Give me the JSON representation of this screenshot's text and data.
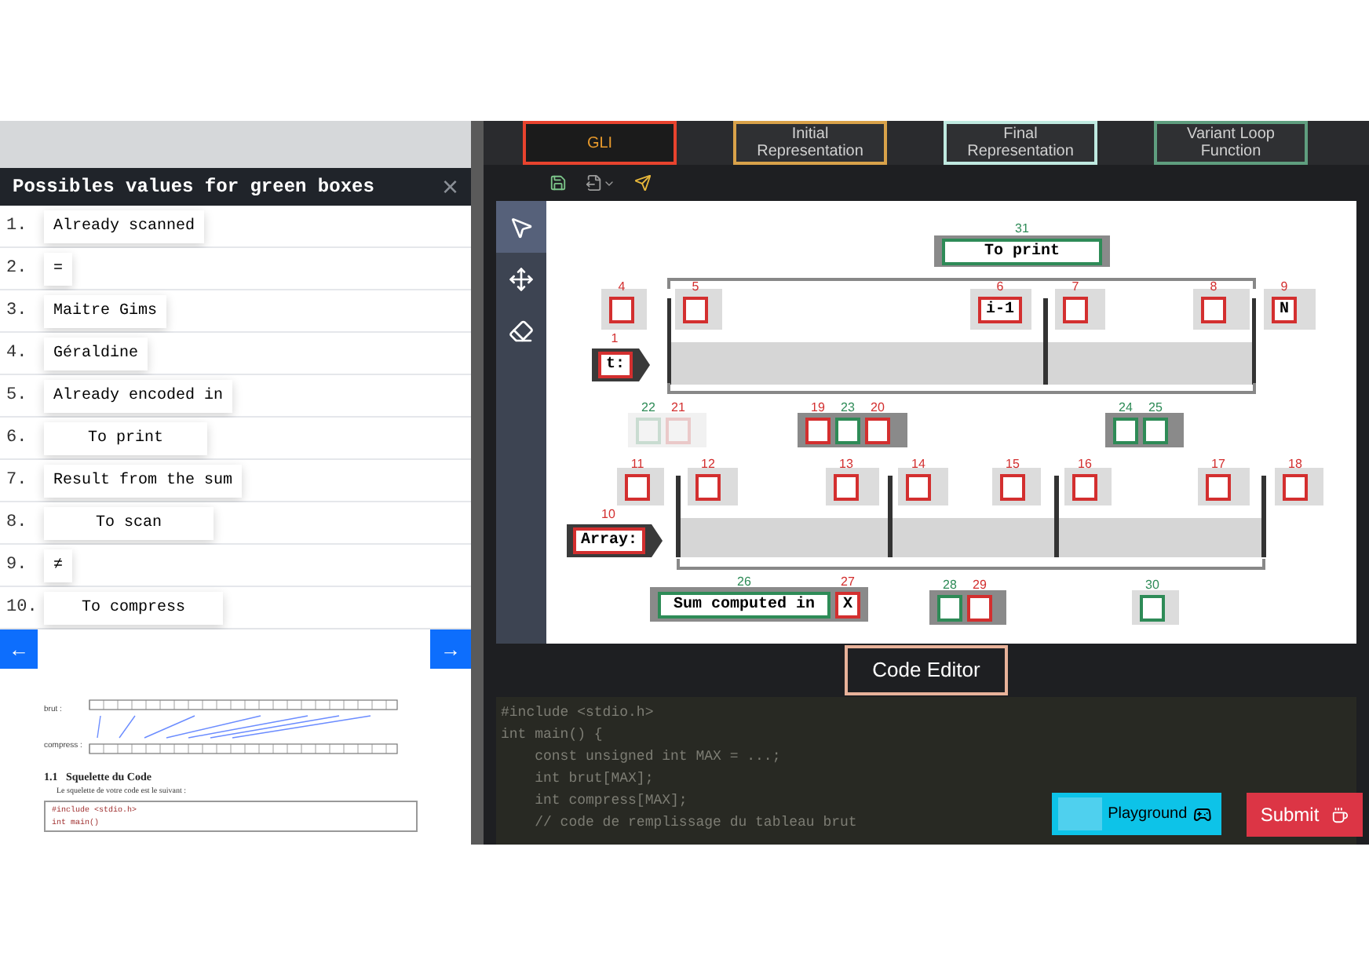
{
  "panel": {
    "title": "Possibles values for green boxes",
    "close": "×",
    "values": [
      {
        "number": "1.",
        "text": "Already scanned"
      },
      {
        "number": "2.",
        "text": "="
      },
      {
        "number": "3.",
        "text": "Maitre Gims"
      },
      {
        "number": "4.",
        "text": "Géraldine"
      },
      {
        "number": "5.",
        "text": "Already encoded in"
      },
      {
        "number": "6.",
        "text": "To print"
      },
      {
        "number": "7.",
        "text": "Result from the sum"
      },
      {
        "number": "8.",
        "text": "To scan"
      },
      {
        "number": "9.",
        "text": "≠"
      },
      {
        "number": "10.",
        "text": "To compress"
      }
    ],
    "prev": "←",
    "next": "→"
  },
  "document": {
    "row_labels": [
      "brut :",
      "compress :"
    ],
    "heading": "1.1   Squelette du Code",
    "sentence": "Le squelette de votre code est le suivant :",
    "code": [
      "#include <stdio.h>",
      "int main()"
    ]
  },
  "tabs": [
    {
      "label": "GLI",
      "selected": true,
      "color": "#e8432e"
    },
    {
      "label": "Initial Representation",
      "selected": false,
      "color": "#d9a24a"
    },
    {
      "label": "Final Representation",
      "selected": false,
      "color": "#bfe9e0"
    },
    {
      "label": "Variant Loop Function",
      "selected": false,
      "color": "#5f9e7f"
    }
  ],
  "tools": [
    {
      "selected": true
    },
    {
      "selected": false
    },
    {
      "selected": false
    }
  ],
  "diagram": {
    "labels": [
      {
        "number": "1",
        "text": "t:"
      },
      {
        "number": "10",
        "text": "Array:"
      }
    ],
    "boxes": [
      {
        "number": "31",
        "color": "#2e8b57",
        "value": "To print",
        "faded": false
      },
      {
        "number": "4",
        "color": "#d32f2f",
        "faded": false
      },
      {
        "number": "5",
        "color": "#d32f2f",
        "faded": false
      },
      {
        "number": "6",
        "color": "#d32f2f",
        "value": "i-1",
        "faded": false
      },
      {
        "number": "7",
        "color": "#d32f2f",
        "faded": false
      },
      {
        "number": "8",
        "color": "#d32f2f",
        "faded": false
      },
      {
        "number": "9",
        "color": "#d32f2f",
        "value": "N",
        "faded": false
      },
      {
        "number": "22",
        "color": "#2e8b57",
        "faded": true
      },
      {
        "number": "21",
        "color": "#d32f2f",
        "faded": true
      },
      {
        "number": "19",
        "color": "#d32f2f",
        "faded": false
      },
      {
        "number": "23",
        "color": "#2e8b57",
        "faded": false
      },
      {
        "number": "20",
        "color": "#d32f2f",
        "faded": false
      },
      {
        "number": "24",
        "color": "#2e8b57",
        "faded": false
      },
      {
        "number": "25",
        "color": "#2e8b57",
        "faded": false
      },
      {
        "number": "11",
        "color": "#d32f2f",
        "faded": false
      },
      {
        "number": "12",
        "color": "#d32f2f",
        "faded": false
      },
      {
        "number": "13",
        "color": "#d32f2f",
        "faded": false
      },
      {
        "number": "14",
        "color": "#d32f2f",
        "faded": false
      },
      {
        "number": "15",
        "color": "#d32f2f",
        "faded": false
      },
      {
        "number": "16",
        "color": "#d32f2f",
        "faded": false
      },
      {
        "number": "17",
        "color": "#d32f2f",
        "faded": false
      },
      {
        "number": "18",
        "color": "#d32f2f",
        "faded": false
      },
      {
        "number": "26",
        "color": "#2e8b57",
        "value": "Sum computed in",
        "faded": false
      },
      {
        "number": "27",
        "color": "#d32f2f",
        "value": "X",
        "faded": false
      },
      {
        "number": "28",
        "color": "#2e8b57",
        "faded": false
      },
      {
        "number": "29",
        "color": "#d32f2f",
        "faded": false
      },
      {
        "number": "30",
        "color": "#2e8b57",
        "faded": false
      }
    ]
  },
  "code_editor": {
    "title": "Code Editor",
    "lines": [
      "#include <stdio.h>",
      "int main() {",
      "    const unsigned int MAX = ...;",
      "    int brut[MAX];",
      "    int compress[MAX];",
      "    // code de remplissage du tableau brut"
    ]
  },
  "buttons": [
    {
      "label": "Playground",
      "kind": "playground"
    },
    {
      "label": "Submit",
      "kind": "submit"
    }
  ]
}
